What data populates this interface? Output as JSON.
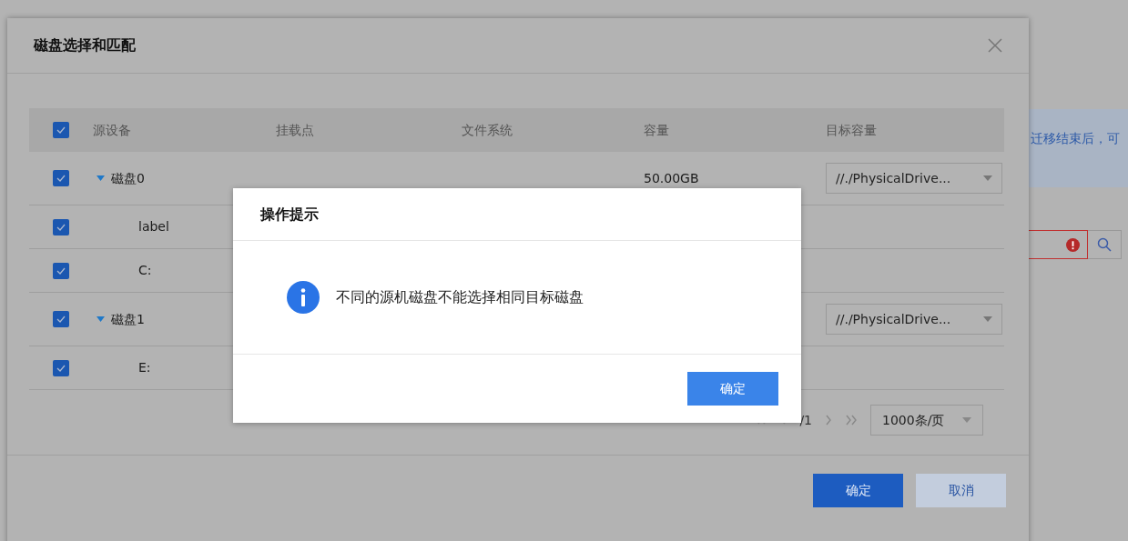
{
  "background_page": {
    "notice_text": "迁移结束后，可",
    "search_field": {
      "error": true
    }
  },
  "dialog": {
    "title": "磁盘选择和匹配",
    "table": {
      "header_checked": true,
      "columns": [
        "源设备",
        "挂载点",
        "文件系统",
        "容量",
        "目标容量"
      ],
      "rows": [
        {
          "name": "磁盘0",
          "checked": true,
          "expanded": true,
          "capacity": "50.00GB",
          "target": "//./PhysicalDrive...",
          "children": [
            {
              "name": "label",
              "checked": true
            },
            {
              "name": "C:",
              "checked": true
            }
          ]
        },
        {
          "name": "磁盘1",
          "checked": true,
          "expanded": true,
          "target": "//./PhysicalDrive...",
          "children": [
            {
              "name": "E:",
              "checked": true
            }
          ]
        }
      ]
    },
    "pagination": {
      "total_pages": "/1",
      "page_size": "1000条/页"
    },
    "buttons": [
      {
        "label": "确定",
        "kind": "primary"
      },
      {
        "label": "取消",
        "kind": "secondary"
      }
    ]
  },
  "alert": {
    "title": "操作提示",
    "message": "不同的源机磁盘不能选择相同目标磁盘",
    "button": "确定"
  }
}
